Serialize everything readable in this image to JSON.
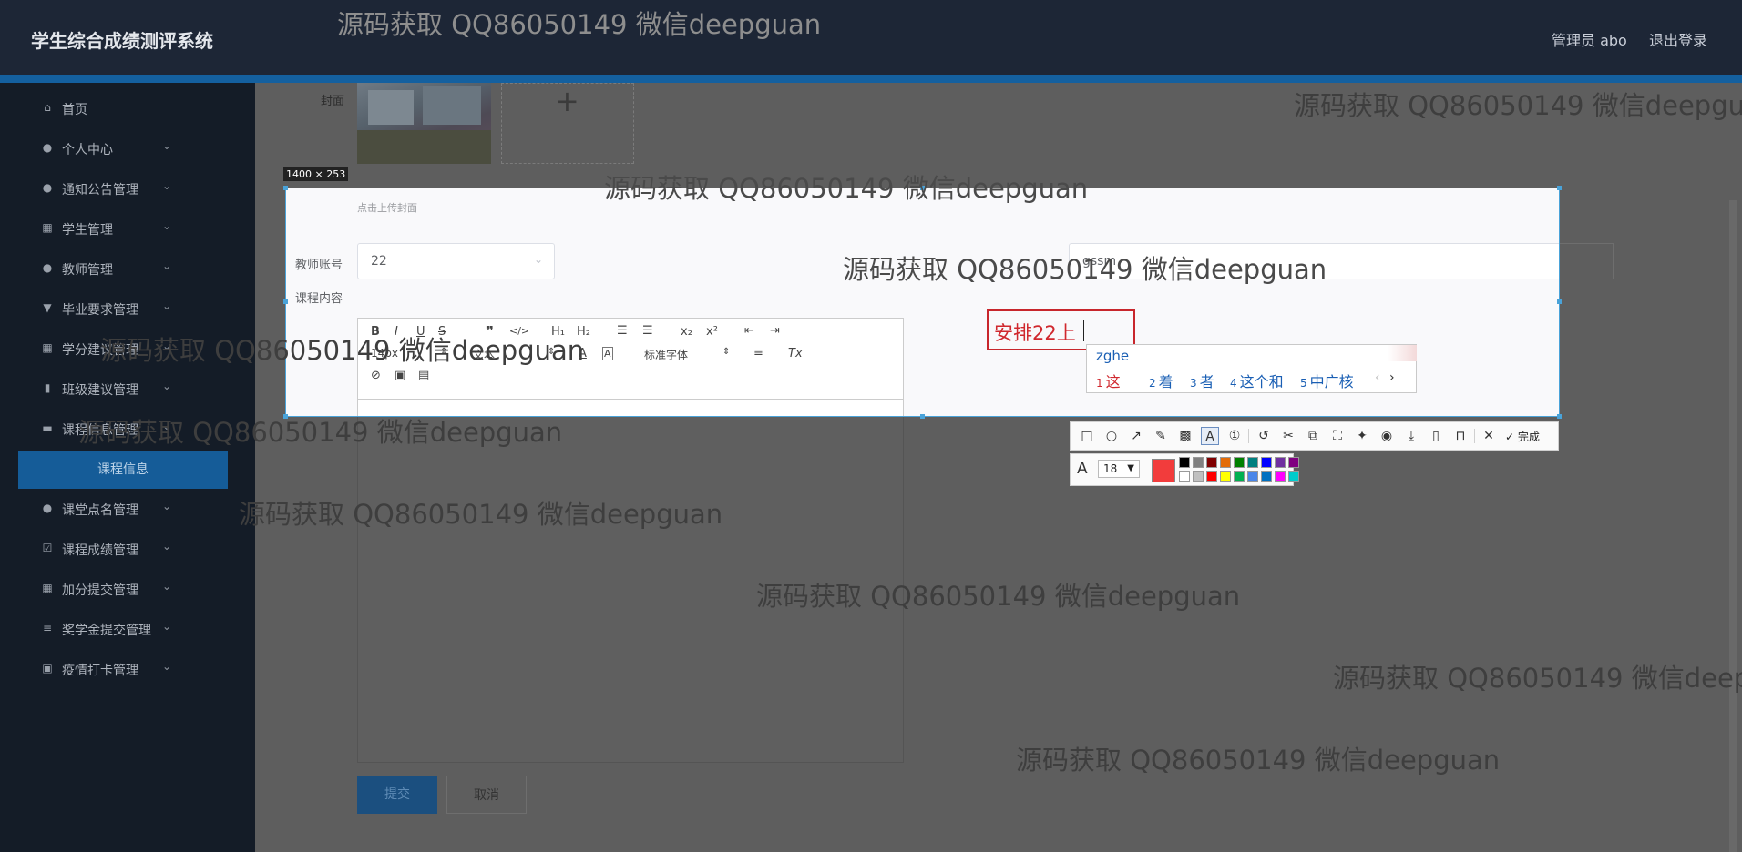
{
  "header": {
    "app_title": "学生综合成绩测评系统",
    "admin_label": "管理员 abo",
    "logout_label": "退出登录"
  },
  "sidebar": {
    "items": [
      {
        "label": "首页",
        "icon": "home-icon",
        "has_children": false
      },
      {
        "label": "个人中心",
        "icon": "user-icon",
        "has_children": true
      },
      {
        "label": "通知公告管理",
        "icon": "location-pin-icon",
        "has_children": true
      },
      {
        "label": "学生管理",
        "icon": "grid-icon",
        "has_children": true
      },
      {
        "label": "教师管理",
        "icon": "user-icon",
        "has_children": true
      },
      {
        "label": "毕业要求管理",
        "icon": "trophy-icon",
        "has_children": true
      },
      {
        "label": "学分建议管理",
        "icon": "grid-icon",
        "has_children": true
      },
      {
        "label": "班级建议管理",
        "icon": "bar-chart-icon",
        "has_children": true
      },
      {
        "label": "课程信息管理",
        "icon": "monitor-icon",
        "has_children": true
      },
      {
        "label": "课堂点名管理",
        "icon": "user-icon",
        "has_children": true
      },
      {
        "label": "课程成绩管理",
        "icon": "check-square-icon",
        "has_children": true
      },
      {
        "label": "加分提交管理",
        "icon": "grid-icon",
        "has_children": true
      },
      {
        "label": "奖学金提交管理",
        "icon": "list-icon",
        "has_children": true
      },
      {
        "label": "疫情打卡管理",
        "icon": "clipboard-icon",
        "has_children": true
      }
    ],
    "active_subitem": "课程信息"
  },
  "form": {
    "cover_label": "封面",
    "upload_hint": "点击上传封面",
    "teacher_account_label": "教师账号",
    "teacher_account_value": "22",
    "teacher_name_value": "gssm",
    "course_content_label": "课程内容",
    "font_size_value": "14px",
    "text_type_value": "文本",
    "font_family_value": "标准字体",
    "submit_label": "提交",
    "cancel_label": "取消"
  },
  "screenshot_tool": {
    "size_badge": "1400 × 253",
    "annotation_text": "安排22上",
    "font_size": "18",
    "done_label": "完成",
    "current_color": "#f23c3c",
    "palette": [
      "#000000",
      "#808080",
      "#800000",
      "#e36c09",
      "#008000",
      "#008080",
      "#0000ff",
      "#7030a0",
      "#800080",
      "#ffffff",
      "#c0c0c0",
      "#ff0000",
      "#ffff00",
      "#00b050",
      "#4a86e8",
      "#0070c0",
      "#ff00ff",
      "#00cccc"
    ]
  },
  "ime": {
    "pinyin": "zghe",
    "candidates": [
      {
        "index": "1",
        "text": "这"
      },
      {
        "index": "2",
        "text": "着"
      },
      {
        "index": "3",
        "text": "者"
      },
      {
        "index": "4",
        "text": "这个和"
      },
      {
        "index": "5",
        "text": "中广核"
      }
    ],
    "prev_glyph": "‹",
    "next_glyph": "›"
  },
  "watermark": "源码获取 QQ86050149 微信deepguan"
}
